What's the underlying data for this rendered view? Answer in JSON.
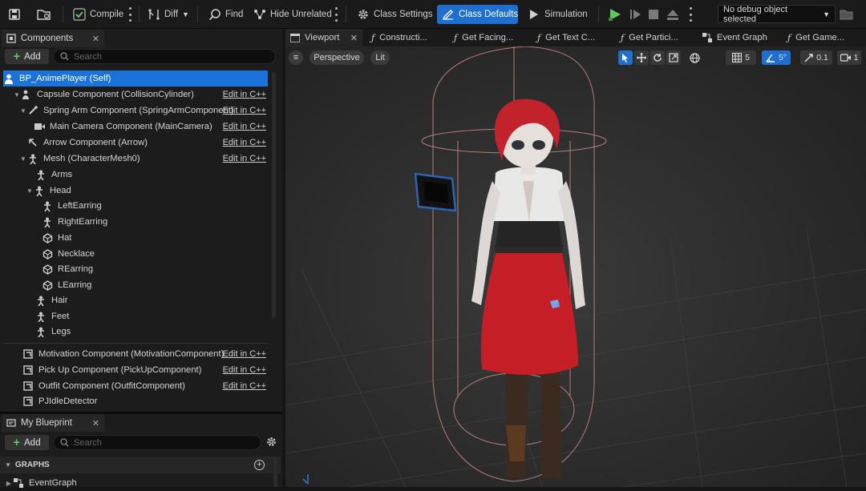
{
  "toolbar": {
    "compile_label": "Compile",
    "diff_label": "Diff",
    "find_label": "Find",
    "hide_unrelated_label": "Hide Unrelated",
    "class_settings_label": "Class Settings",
    "class_defaults_label": "Class Defaults",
    "simulation_label": "Simulation",
    "debug_object_label": "No debug object selected"
  },
  "components_panel": {
    "tab_label": "Components",
    "add_label": "Add",
    "search_placeholder": "Search",
    "rows": [
      {
        "label": "BP_AnimePlayer (Self)",
        "edit": ""
      },
      {
        "label": "Capsule Component (CollisionCylinder)",
        "edit": "Edit in C++"
      },
      {
        "label": "Spring Arm Component (SpringArmComponent)",
        "edit": "Edit in C++"
      },
      {
        "label": "Main Camera Component (MainCamera)",
        "edit": "Edit in C++"
      },
      {
        "label": "Arrow Component (Arrow)",
        "edit": "Edit in C++"
      },
      {
        "label": "Mesh (CharacterMesh0)",
        "edit": "Edit in C++"
      },
      {
        "label": "Arms",
        "edit": ""
      },
      {
        "label": "Head",
        "edit": ""
      },
      {
        "label": "LeftEarring",
        "edit": ""
      },
      {
        "label": "RightEarring",
        "edit": ""
      },
      {
        "label": "Hat",
        "edit": ""
      },
      {
        "label": "Necklace",
        "edit": ""
      },
      {
        "label": "REarring",
        "edit": ""
      },
      {
        "label": "LEarring",
        "edit": ""
      },
      {
        "label": "Hair",
        "edit": ""
      },
      {
        "label": "Feet",
        "edit": ""
      },
      {
        "label": "Legs",
        "edit": ""
      },
      {
        "label": "Motivation Component (MotivationComponent)",
        "edit": "Edit in C++"
      },
      {
        "label": "Pick Up Component (PickUpComponent)",
        "edit": "Edit in C++"
      },
      {
        "label": "Outfit Component (OutfitComponent)",
        "edit": "Edit in C++"
      },
      {
        "label": "PJIdleDetector",
        "edit": ""
      }
    ]
  },
  "blueprint_panel": {
    "tab_label": "My Blueprint",
    "add_label": "Add",
    "search_placeholder": "Search",
    "graphs_header": "GRAPHS",
    "graph_items": [
      "EventGraph"
    ]
  },
  "viewport": {
    "tabs": [
      "Viewport",
      "Constructi...",
      "Get Facing...",
      "Get Text C...",
      "Get Partici...",
      "Event Graph",
      "Get Game..."
    ],
    "perspective_label": "Perspective",
    "lit_label": "Lit",
    "grid_snap_value": "5",
    "rotation_snap_value": "5°",
    "scale_snap_value": "0.1",
    "camera_speed_value": "1"
  },
  "colors": {
    "accent": "#1f6fd0",
    "selection": "#1b73d9",
    "play_green": "#5fc75f"
  }
}
